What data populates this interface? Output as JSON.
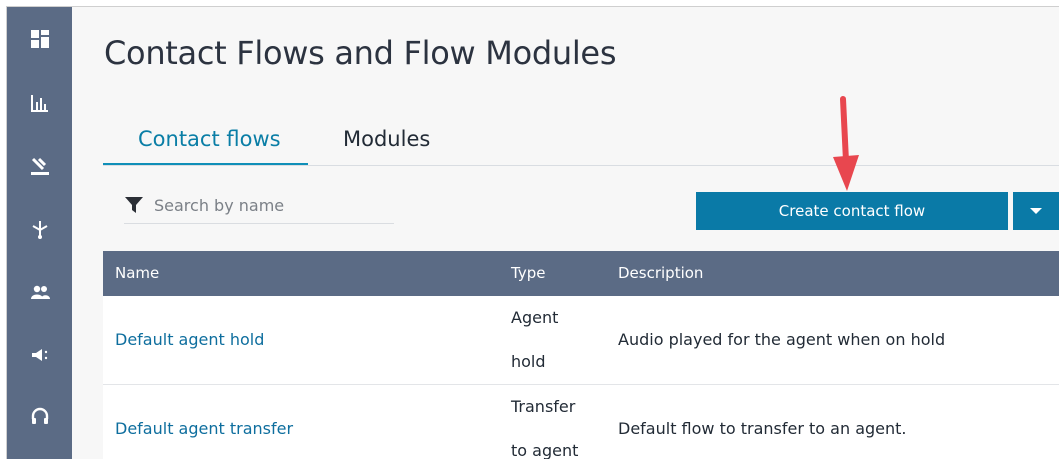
{
  "sidebar": {
    "items": [
      {
        "icon": "dashboard-icon"
      },
      {
        "icon": "metrics-icon"
      },
      {
        "icon": "routing-icon"
      },
      {
        "icon": "channels-icon"
      },
      {
        "icon": "users-icon"
      },
      {
        "icon": "campaigns-icon"
      },
      {
        "icon": "headset-icon"
      }
    ]
  },
  "page": {
    "title": "Contact Flows and Flow Modules"
  },
  "tabs": [
    {
      "label": "Contact flows",
      "active": true
    },
    {
      "label": "Modules",
      "active": false
    }
  ],
  "search": {
    "placeholder": "Search by name",
    "value": ""
  },
  "actions": {
    "create_label": "Create contact flow"
  },
  "colors": {
    "accent": "#0a7aa7",
    "sidebar": "#5b6b85",
    "annotation_arrow": "#e8474f",
    "link": "#0e6e9e"
  },
  "table": {
    "columns": [
      "Name",
      "Type",
      "Description"
    ],
    "rows": [
      {
        "name": "Default agent hold",
        "type_line1": "Agent",
        "type_line2": "hold",
        "description": "Audio played for the agent when on hold"
      },
      {
        "name": "Default agent transfer",
        "type_line1": "Transfer",
        "type_line2": "to agent",
        "description": "Default flow to transfer to an agent."
      }
    ]
  }
}
